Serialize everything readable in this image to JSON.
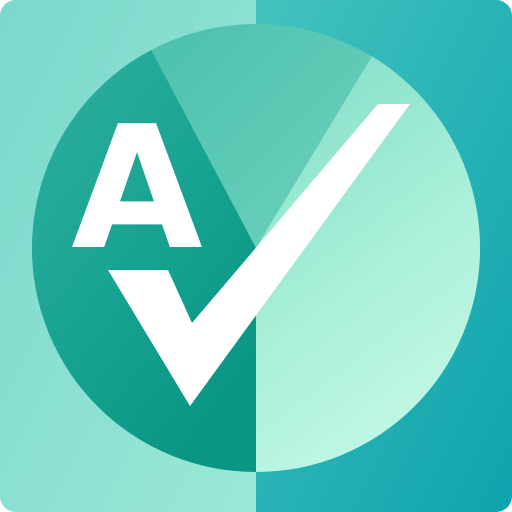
{
  "icon": {
    "letter": "A",
    "symbol": "checkmark-icon",
    "colors": {
      "tile_light": "#7FDCCB",
      "tile_dark": "#12A7AE",
      "circle_dark": "#0E9E8E",
      "circle_mid": "#4FC3AF",
      "circle_light": "#C8FBE6",
      "glyph": "#FFFFFF"
    }
  }
}
